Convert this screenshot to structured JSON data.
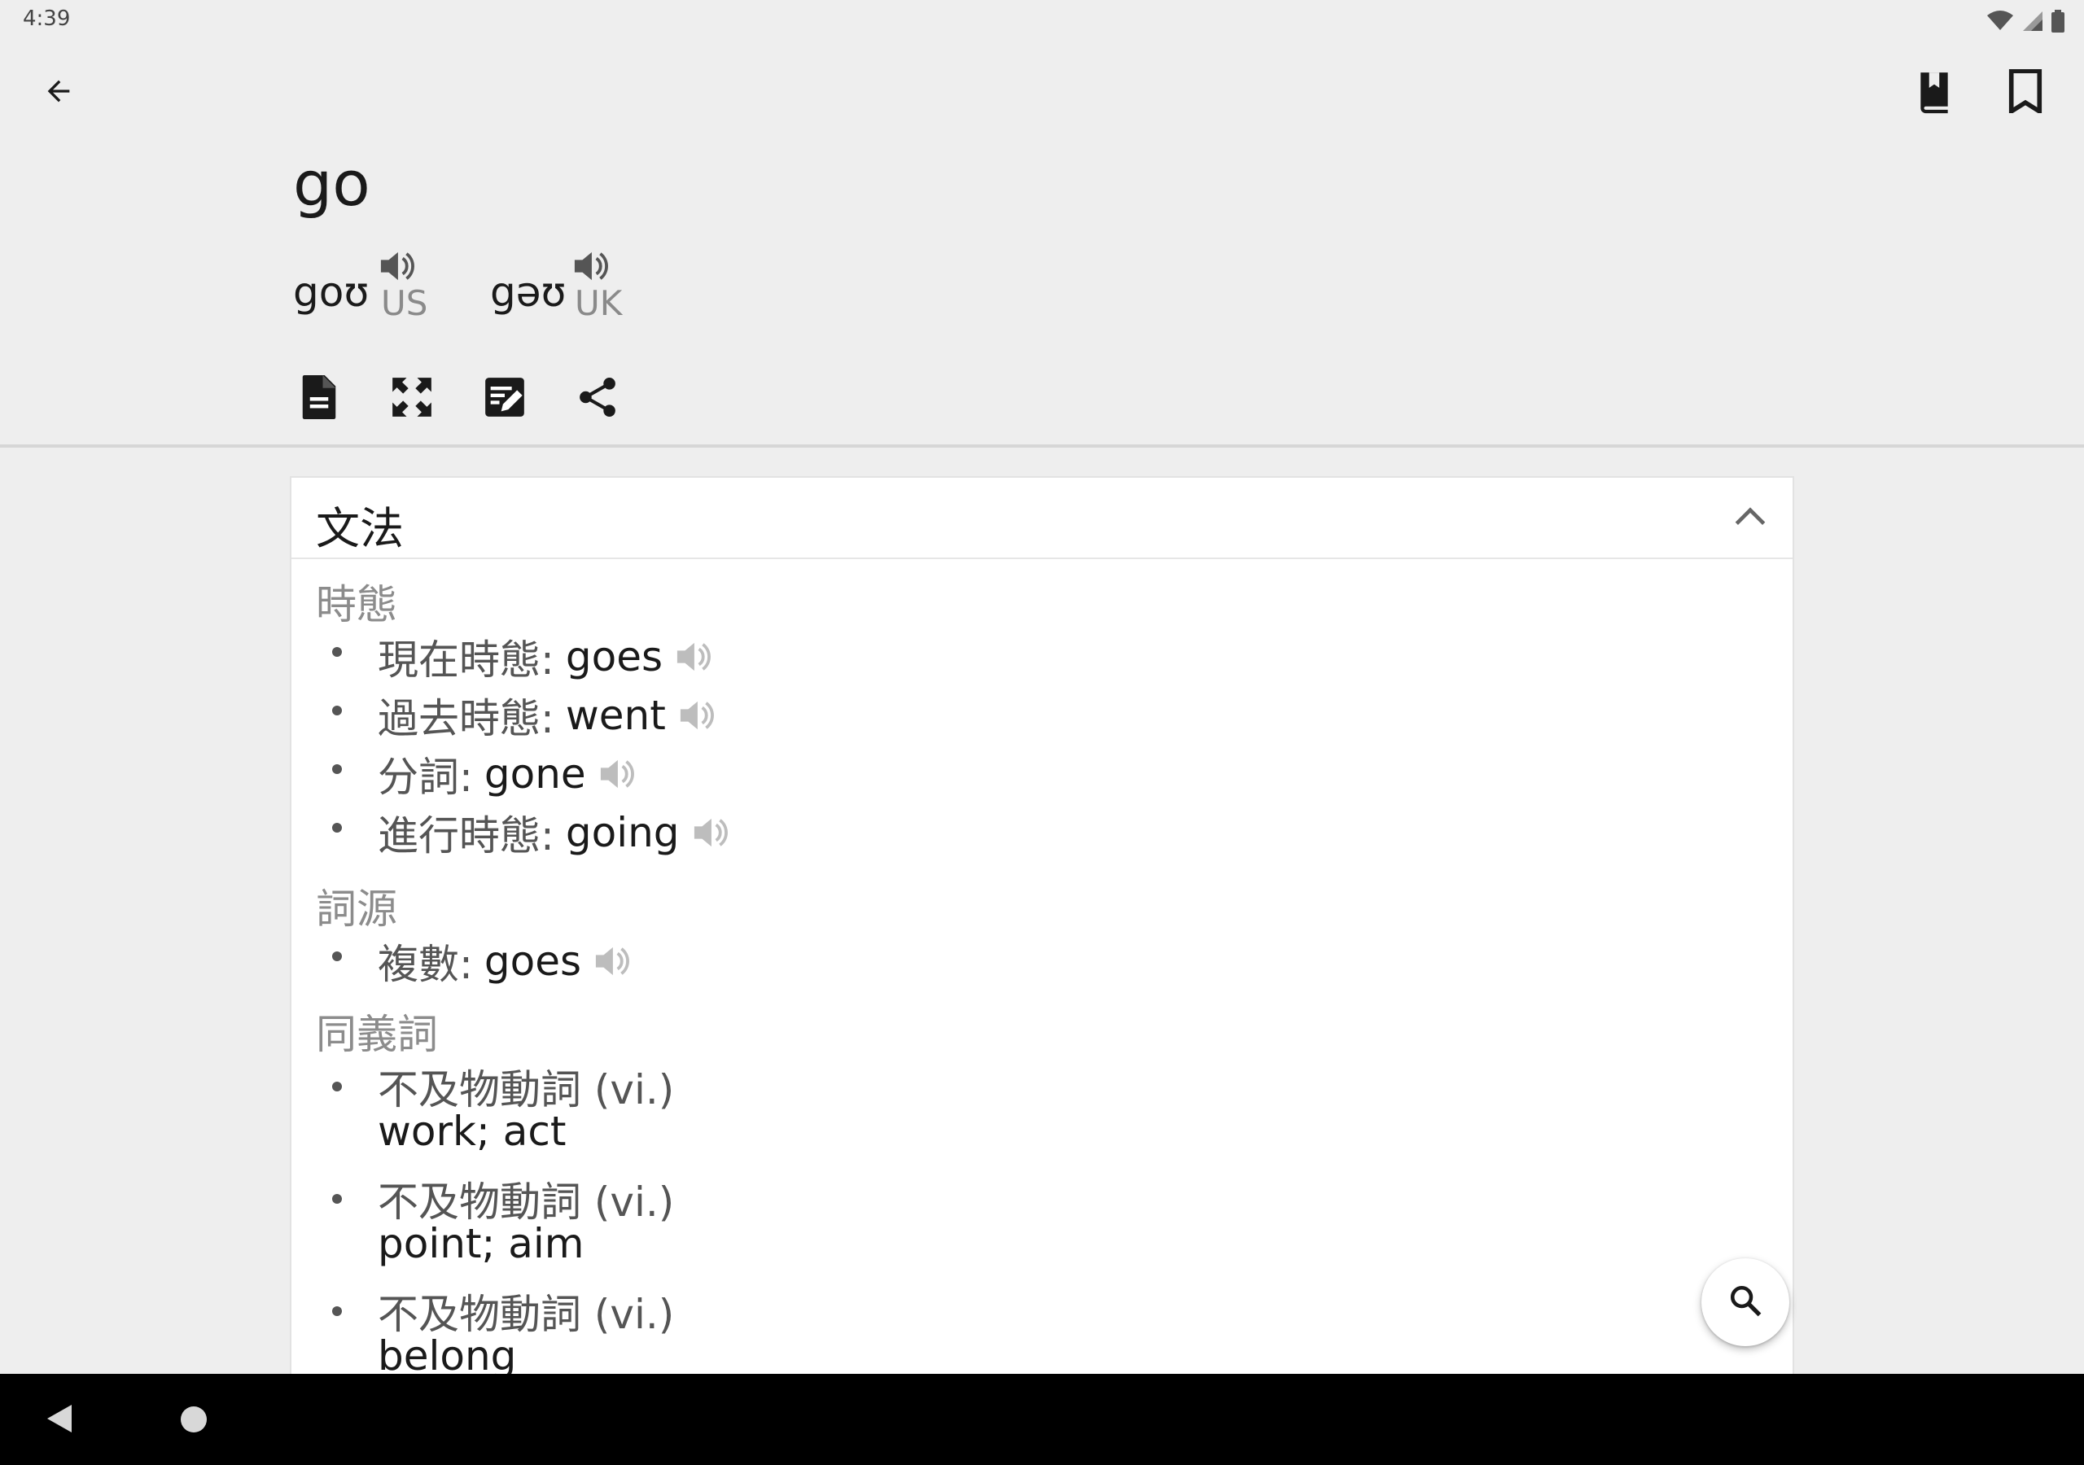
{
  "status_bar": {
    "time": "4:39",
    "icons": [
      "wifi-icon",
      "signal-icon",
      "battery-icon"
    ]
  },
  "app_bar": {
    "back_icon": "arrow-left-icon",
    "actions": [
      "book-bookmark-icon",
      "bookmark-icon"
    ]
  },
  "entry": {
    "word": "go",
    "pronunciations": [
      {
        "ipa": "goʊ",
        "region": "US",
        "icon": "speaker-icon"
      },
      {
        "ipa": "gəʊ",
        "region": "UK",
        "icon": "speaker-icon"
      }
    ],
    "tools": [
      "document-icon",
      "fullscreen-icon",
      "edit-note-icon",
      "share-icon"
    ]
  },
  "grammar_card": {
    "title": "文法",
    "collapse_icon": "chevron-up-icon",
    "sections": {
      "tenses": {
        "title": "時態",
        "items": [
          {
            "label": "現在時態:",
            "word": "goes"
          },
          {
            "label": "過去時態:",
            "word": "went"
          },
          {
            "label": "分詞:",
            "word": "gone"
          },
          {
            "label": "進行時態:",
            "word": "going"
          }
        ]
      },
      "etymology": {
        "title": "詞源",
        "items": [
          {
            "label": "複數:",
            "word": "goes"
          }
        ]
      },
      "synonyms": {
        "title": "同義詞",
        "items": [
          {
            "pos": "不及物動詞 (vi.)",
            "def": "work; act"
          },
          {
            "pos": "不及物動詞 (vi.)",
            "def": "point; aim"
          },
          {
            "pos": "不及物動詞 (vi.)",
            "def": "belong"
          }
        ]
      }
    }
  },
  "fab": {
    "icon": "search-icon"
  },
  "nav_bar": {
    "icons": [
      "nav-back-icon",
      "nav-home-icon"
    ]
  },
  "colors": {
    "background": "#eeeeee",
    "card": "#ffffff",
    "muted_text": "#8c8c8c",
    "speaker_muted": "#bdbdbd",
    "nav_bar": "#000000"
  }
}
